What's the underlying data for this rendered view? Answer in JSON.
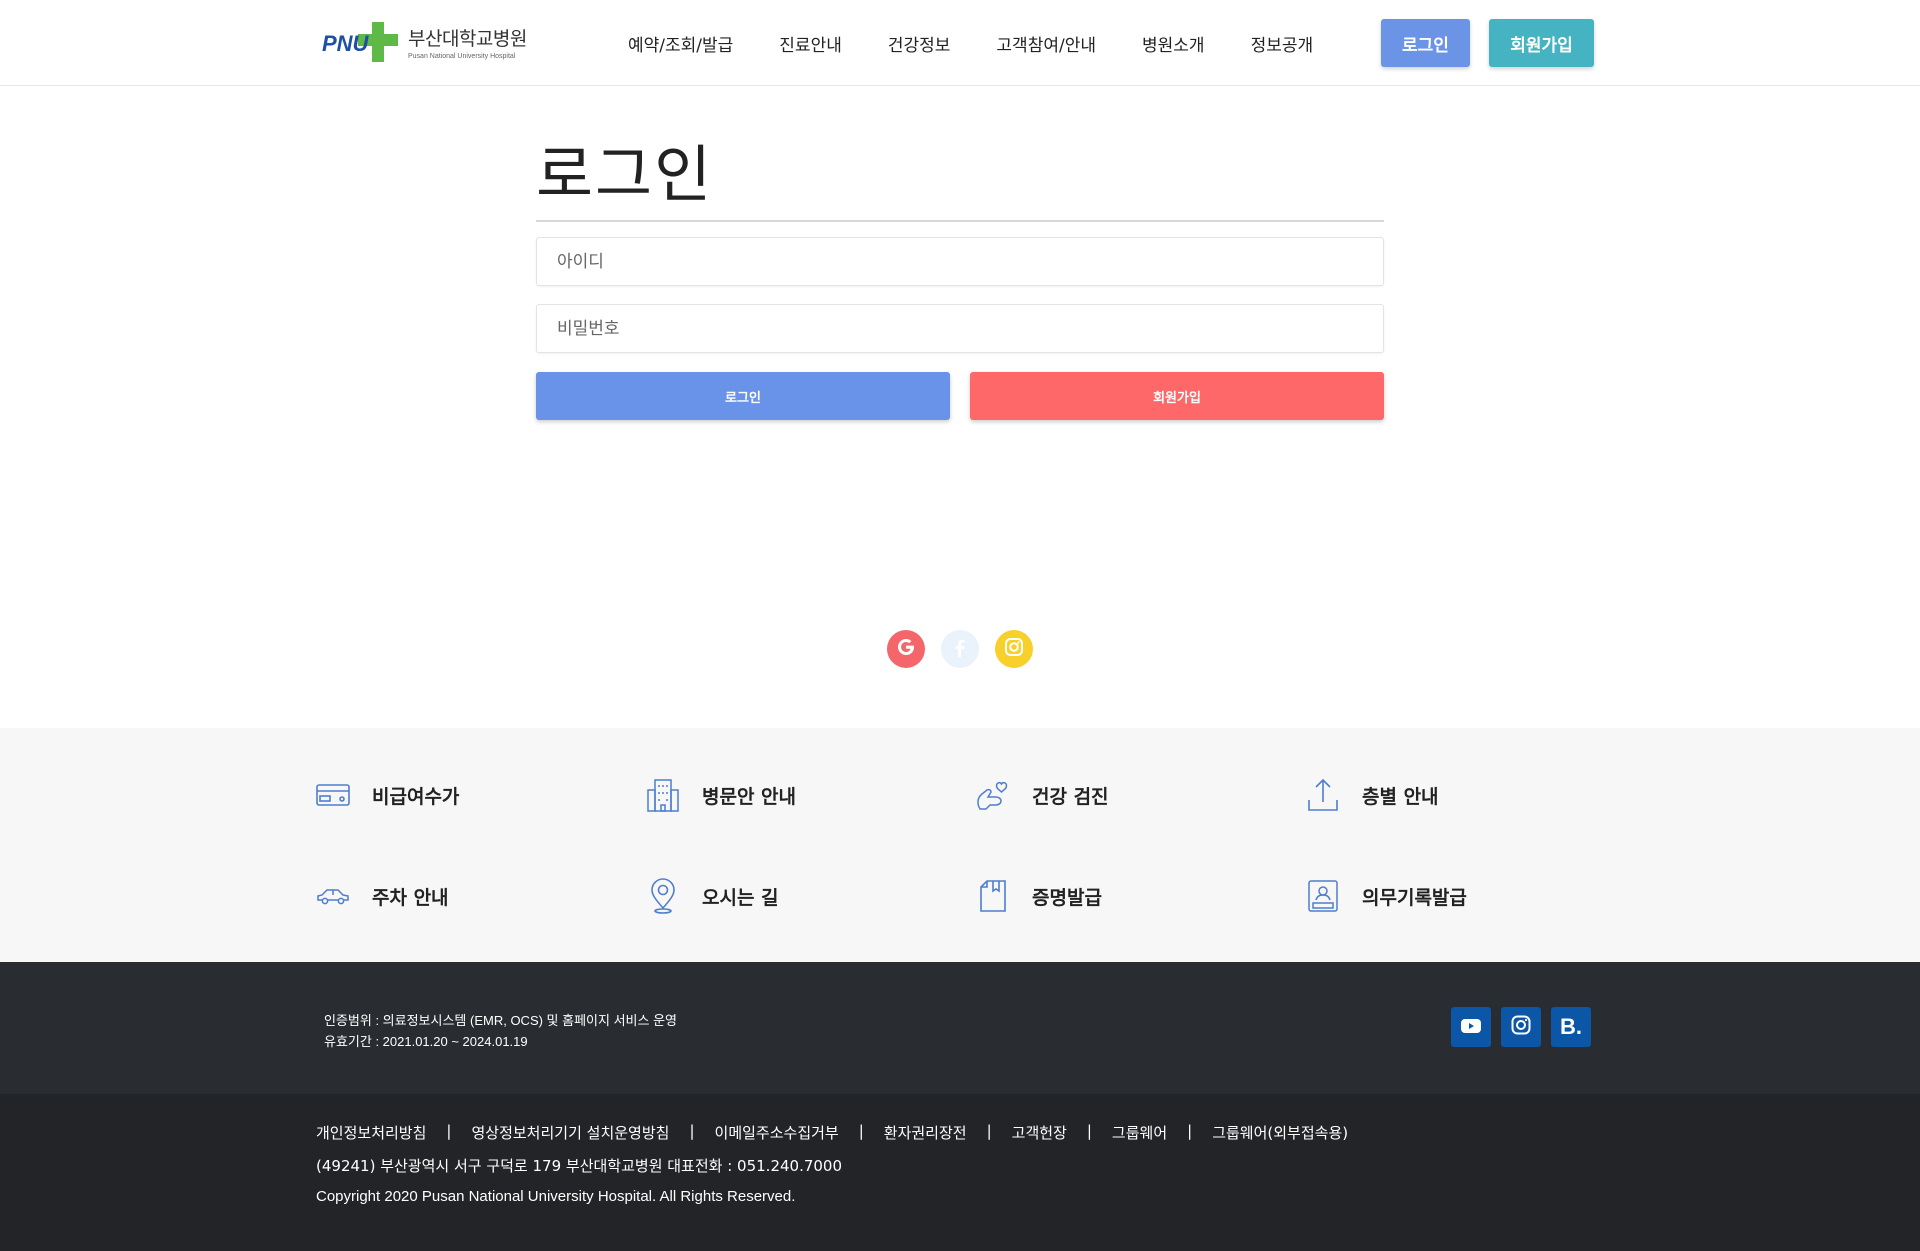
{
  "header": {
    "logo_name": "부산대학교병원",
    "logo_sub": "Pusan National University Hospital",
    "logo_mark": "PNU",
    "nav": [
      "예약/조회/발급",
      "진료안내",
      "건강정보",
      "고객참여/안내",
      "병원소개",
      "정보공개"
    ],
    "login_button": "로그인",
    "join_button": "회원가입"
  },
  "login": {
    "title": "로그인",
    "id_placeholder": "아이디",
    "pw_placeholder": "비밀번호",
    "login_button": "로그인",
    "join_button": "회원가입"
  },
  "social": [
    "google-icon",
    "facebook-icon",
    "instagram-icon"
  ],
  "quick_menu": [
    {
      "label": "비급여수가",
      "icon": "card-icon"
    },
    {
      "label": "병문안 안내",
      "icon": "building-icon"
    },
    {
      "label": "건강 검진",
      "icon": "heart-hand-icon"
    },
    {
      "label": "층별 안내",
      "icon": "upload-icon"
    },
    {
      "label": "주차 안내",
      "icon": "car-icon"
    },
    {
      "label": "오시는 길",
      "icon": "map-pin-icon"
    },
    {
      "label": "증명발급",
      "icon": "document-icon"
    },
    {
      "label": "의무기록발급",
      "icon": "id-card-icon"
    }
  ],
  "footer": {
    "cert_scope": "인증범위 : 의료정보시스템 (EMR, OCS) 및 홈페이지 서비스 운영",
    "cert_period": "유효기간 : 2021.01.20 ~ 2024.01.19",
    "links": [
      "개인정보처리방침",
      "영상정보처리기기 설치운영방침",
      "이메일주소수집거부",
      "환자권리장전",
      "고객헌장",
      "그룹웨어",
      "그룹웨어(외부접속용)"
    ],
    "separator": "|",
    "address": "(49241) 부산광역시 서구 구덕로 179 부산대학교병원 대표전화 : 051.240.7000",
    "copyright": "Copyright 2020 Pusan National University Hospital. All Rights Reserved.",
    "sns": [
      "youtube-icon",
      "instagram-icon",
      "blog-icon"
    ],
    "blog_letter": "B."
  },
  "colors": {
    "primary_blue": "#6993e8",
    "teal": "#45b3c2",
    "coral": "#ff6868",
    "footer_dark": "#292c30",
    "sns_blue": "#0b56a6"
  }
}
